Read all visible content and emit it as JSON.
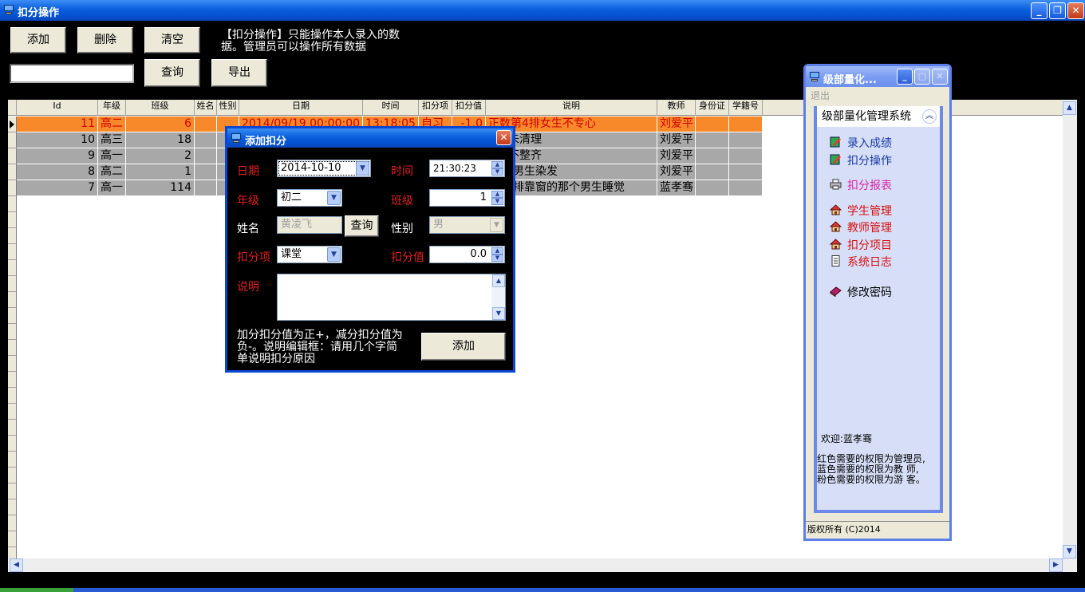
{
  "window": {
    "title": "扣分操作"
  },
  "toolbar": {
    "add": "添加",
    "delete": "删除",
    "clear": "清空",
    "query": "查询",
    "export": "导出",
    "notice_line1": "【扣分操作】只能操作本人录入的数",
    "notice_line2": "据。管理员可以操作所有数据",
    "search_value": ""
  },
  "grid": {
    "columns": [
      "Id",
      "年级",
      "班级",
      "姓名",
      "性别",
      "日期",
      "时间",
      "扣分项",
      "扣分值",
      "说明",
      "教师",
      "身份证",
      "学籍号"
    ],
    "rows": [
      {
        "id": "11",
        "grade": "高二",
        "class": "6",
        "name": "",
        "gender": "",
        "date": "2014/09/19 00:00:00",
        "time": "13:18:05",
        "item": "自习",
        "value": "-1.0",
        "desc": "正数第4排女生不专心",
        "teacher": "刘爱平"
      },
      {
        "id": "10",
        "grade": "高三",
        "class": "18",
        "name": "",
        "gender": "",
        "date": "",
        "time": "",
        "item": "",
        "value": "",
        "desc": "未清理",
        "teacher": "刘爱平"
      },
      {
        "id": "9",
        "grade": "高一",
        "class": "2",
        "name": "",
        "gender": "",
        "date": "",
        "time": "",
        "item": "",
        "value": "",
        "desc": "不整齐",
        "teacher": "刘爱平"
      },
      {
        "id": "8",
        "grade": "高二",
        "class": "1",
        "name": "",
        "gender": "",
        "date": "",
        "time": "",
        "item": "",
        "value": "",
        "desc": "排男生染发",
        "teacher": "刘爱平"
      },
      {
        "id": "7",
        "grade": "高一",
        "class": "114",
        "name": "",
        "gender": "",
        "date": "",
        "time": "",
        "item": "",
        "value": "",
        "desc": "第六排靠窗的那个男生睡觉",
        "teacher": "蓝孝骞"
      }
    ]
  },
  "dialog": {
    "title": "添加扣分",
    "date_label": "日期",
    "date_value": "2014-10-10",
    "time_label": "时间",
    "time_value": "21:30:23",
    "grade_label": "年级",
    "grade_value": "初二",
    "class_label": "班级",
    "class_value": "1",
    "name_label": "姓名",
    "name_value": "黄凌飞",
    "query_button": "查询",
    "gender_label": "性别",
    "gender_value": "男",
    "item_label": "扣分项",
    "item_value": "课堂",
    "value_label": "扣分值",
    "value_value": "0.0",
    "desc_label": "说明",
    "hint_line1": "加分扣分值为正+，减分扣分值为",
    "hint_line2": "负-。说明编辑框：请用几个字简",
    "hint_line3": "单说明扣分原因",
    "add_button": "添加"
  },
  "panel": {
    "title": "级部量化...",
    "menu_exit": "退出",
    "group_title": "级部量化管理系统",
    "items": [
      {
        "label": "录入成绩",
        "color": "#1a3aa8"
      },
      {
        "label": "扣分操作",
        "color": "#1a3aa8"
      },
      {
        "label": "扣分报表",
        "color": "#e020a8"
      },
      {
        "label": "学生管理",
        "color": "#d81010"
      },
      {
        "label": "教师管理",
        "color": "#d81010"
      },
      {
        "label": "扣分项目",
        "color": "#d81010"
      },
      {
        "label": "系统日志",
        "color": "#d81010"
      },
      {
        "label": "修改密码",
        "color": "#000000"
      }
    ],
    "welcome": "欢迎:蓝孝骞",
    "perm_line1": "红色需要的权限为管理员,",
    "perm_line2": "蓝色需要的权限为教 师,",
    "perm_line3": "粉色需要的权限为游 客。",
    "footer": "版权所有 (C)2014"
  },
  "colors": {
    "selected_row": "#f7892a",
    "row": "#a8a8a8",
    "dialog_border": "#0a47d2",
    "panel_border": "#5b7fe6"
  }
}
